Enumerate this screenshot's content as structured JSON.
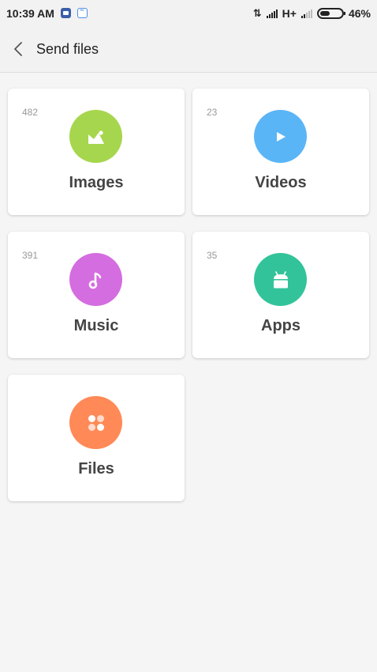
{
  "status_bar": {
    "time": "10:39 AM",
    "network": "H+",
    "battery_percent": "46%",
    "battery_level": 0.46
  },
  "header": {
    "title": "Send files"
  },
  "categories": [
    {
      "label": "Images",
      "count": "482",
      "color": "#a6d64d",
      "icon": "image-icon"
    },
    {
      "label": "Videos",
      "count": "23",
      "color": "#5ab5f7",
      "icon": "play-icon"
    },
    {
      "label": "Music",
      "count": "391",
      "color": "#d46de0",
      "icon": "music-note-icon"
    },
    {
      "label": "Apps",
      "count": "35",
      "color": "#33c39a",
      "icon": "android-icon"
    },
    {
      "label": "Files",
      "count": "",
      "color": "#ff8a57",
      "icon": "files-grid-icon"
    }
  ]
}
